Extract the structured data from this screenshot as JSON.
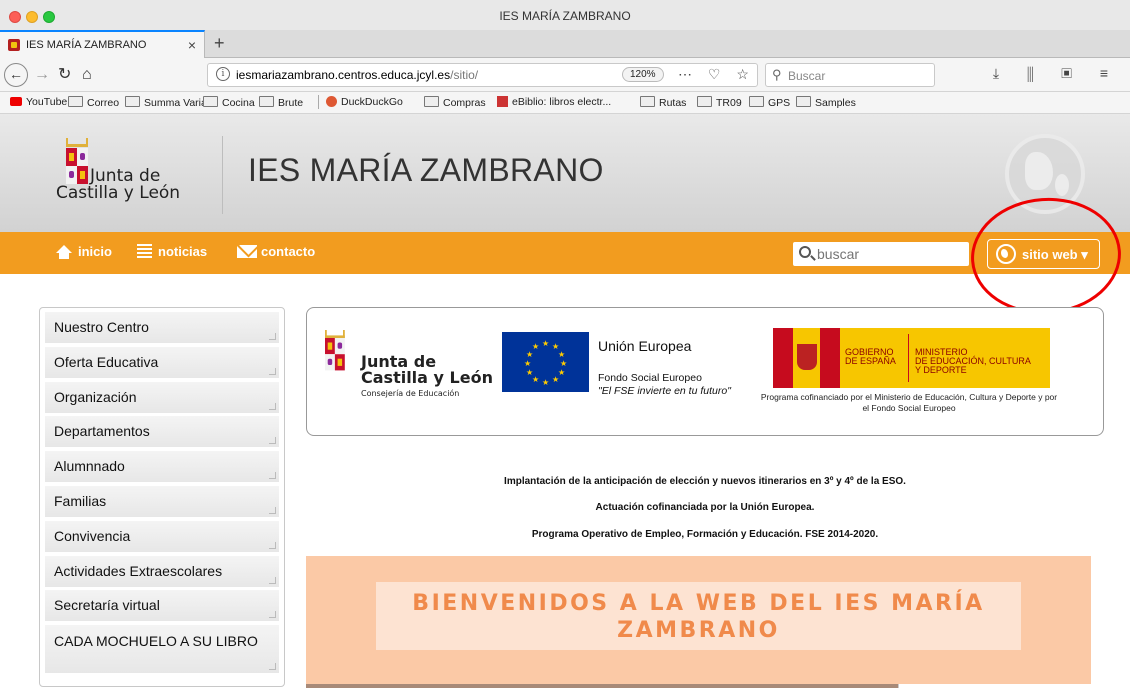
{
  "browser": {
    "window_title": "IES MARÍA ZAMBRANO",
    "tab_title": "IES MARÍA ZAMBRANO",
    "new_tab": "+",
    "url_host": "iesmariazambrano.centros.educa.jcyl.es",
    "url_path": "/sitio/",
    "zoom": "120%",
    "search_placeholder": "Buscar",
    "bookmarks": [
      "YouTube",
      "Correo",
      "Summa Varia",
      "Cocina",
      "Brute",
      "DuckDuckGo",
      "Compras",
      "eBiblio: libros electr...",
      "Rutas",
      "TR09",
      "GPS",
      "Samples"
    ]
  },
  "header": {
    "logo_line1": "Junta de",
    "logo_line2": "Castilla y León",
    "site_title": "IES MARÍA ZAMBRANO"
  },
  "nav": {
    "inicio": "inicio",
    "noticias": "noticias",
    "contacto": "contacto",
    "search_placeholder": "buscar",
    "sitio_web": "sitio web ▾"
  },
  "sidebar": {
    "items": [
      "Nuestro Centro",
      "Oferta Educativa",
      "Organización",
      "Departamentos",
      "Alumnnado",
      "Familias",
      "Convivencia",
      "Actividades Extraescolares",
      "Secretaría virtual",
      "CADA MOCHUELO A SU LIBRO"
    ]
  },
  "logos": {
    "jcyl_line1": "Junta de",
    "jcyl_line2": "Castilla y León",
    "jcyl_line3": "Consejería de Educación",
    "eu_title": "Unión Europea",
    "eu_fund": "Fondo Social Europeo",
    "eu_motto": "\"El FSE invierte en tu futuro\"",
    "gov_line1": "GOBIERNO\nDE ESPAÑA",
    "gov_line2": "MINISTERIO\nDE EDUCACIÓN, CULTURA\nY DEPORTE",
    "gov_caption": "Programa cofinanciado por el Ministerio de Educación, Cultura y Deporte y por el Fondo Social Europeo"
  },
  "notices": {
    "line1": "Implantación de la anticipación de elección y nuevos itinerarios en 3º y 4º de la ESO.",
    "line2": "Actuación cofinanciada por la Unión Europea.",
    "line3": "Programa Operativo de Empleo, Formación y Educación. FSE 2014-2020."
  },
  "welcome": {
    "line1": "BIENVENIDOS A LA WEB DEL IES MARÍA",
    "line2": "ZAMBRANO"
  },
  "colors": {
    "nav_orange": "#f29c1f",
    "annotation_red": "#e00000",
    "welcome_peach": "#fbc9a6",
    "welcome_text": "#f08a4b"
  }
}
